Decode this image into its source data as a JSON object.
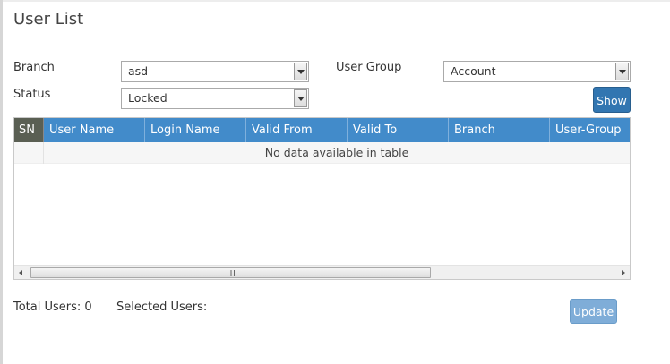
{
  "page": {
    "title": "User List"
  },
  "filters": {
    "branch_label": "Branch",
    "branch_value": "asd",
    "user_group_label": "User Group",
    "user_group_value": "Account",
    "status_label": "Status",
    "status_value": "Locked",
    "show_label": "Show"
  },
  "table": {
    "columns": [
      "SN",
      "User Name",
      "Login Name",
      "Valid From",
      "Valid To",
      "Branch",
      "User-Group"
    ],
    "empty_message": "No data available in table"
  },
  "footer": {
    "total_users": "Total Users: 0",
    "selected_users": "Selected Users:",
    "update_label": "Update"
  },
  "colors": {
    "header_blue": "#428bca",
    "sn_header": "#5a5f53",
    "show_button": "#3276b1",
    "update_button": "#7fadd8"
  },
  "icons": {
    "dropdown": "chevron-down-icon",
    "scroll_left": "arrow-left-icon",
    "scroll_right": "arrow-right-icon",
    "grip": "grip-icon"
  }
}
